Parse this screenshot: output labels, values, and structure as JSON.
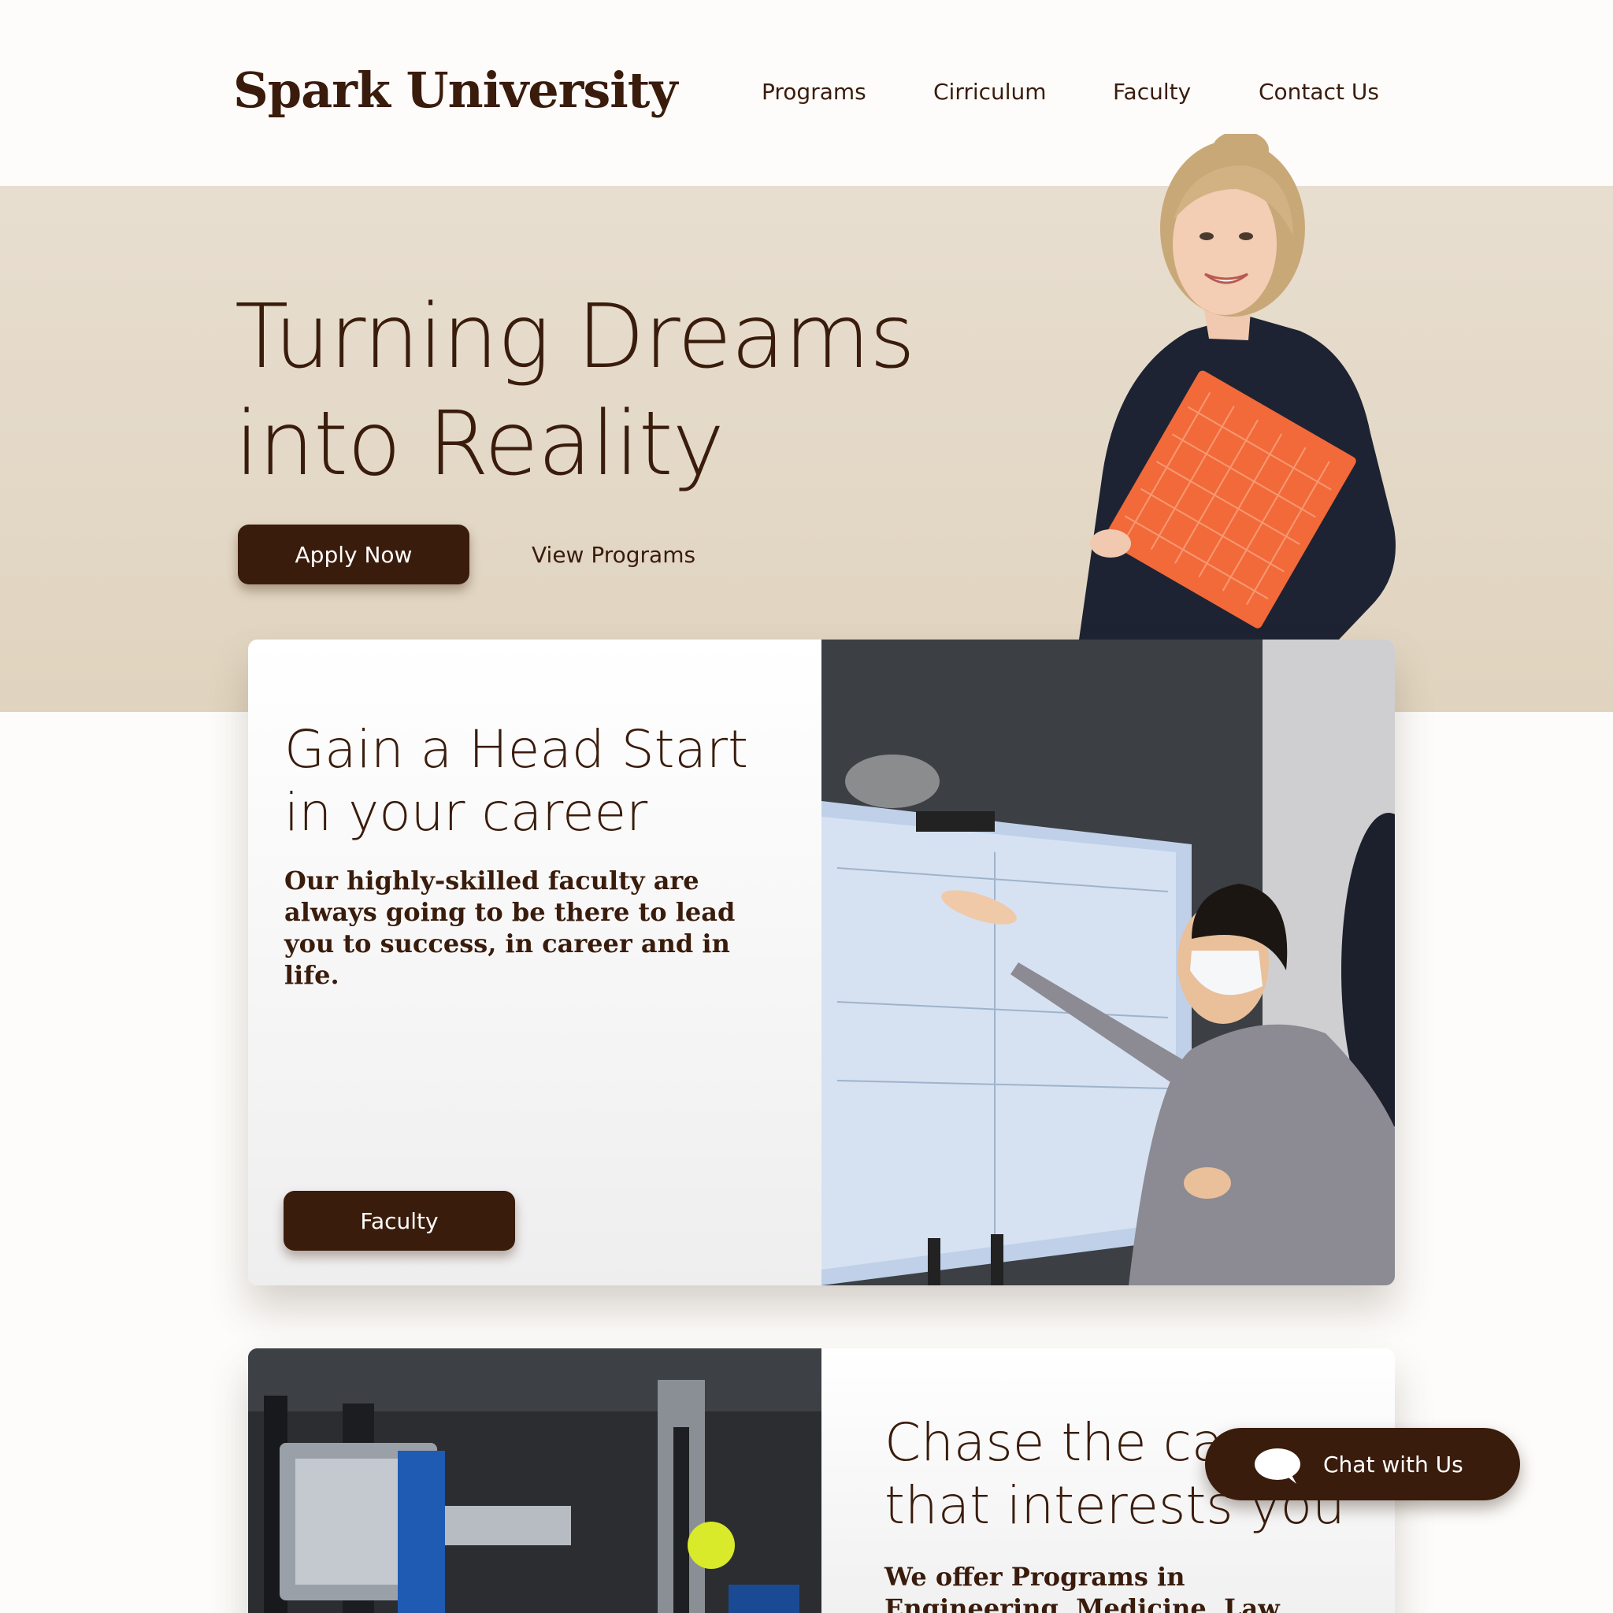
{
  "header": {
    "logo": "Spark University",
    "nav": [
      {
        "label": "Programs"
      },
      {
        "label": "Cirriculum"
      },
      {
        "label": "Faculty"
      },
      {
        "label": "Contact Us"
      }
    ]
  },
  "hero": {
    "title_line1": "Turning Dreams",
    "title_line2": "into Reality",
    "primary_button": "Apply Now",
    "secondary_link": "View Programs"
  },
  "card_faculty": {
    "heading_line1": "Gain a Head Start",
    "heading_line2": "in your career",
    "body": "Our highly-skilled faculty are always going to be there to lead you to success, in career and in life.",
    "button": "Faculty"
  },
  "card_programs": {
    "heading_line1": "Chase the career",
    "heading_line2": "that interests you",
    "body": "We offer Programs in Engineering, Medicine, Law, Business, Arts, Design,"
  },
  "chat": {
    "label": "Chat with Us",
    "icon": "speech-bubble-icon"
  },
  "colors": {
    "brand_dark": "#3a1c0c",
    "hero_band": "#e6dccd",
    "page_bg": "#fdfcfa"
  }
}
